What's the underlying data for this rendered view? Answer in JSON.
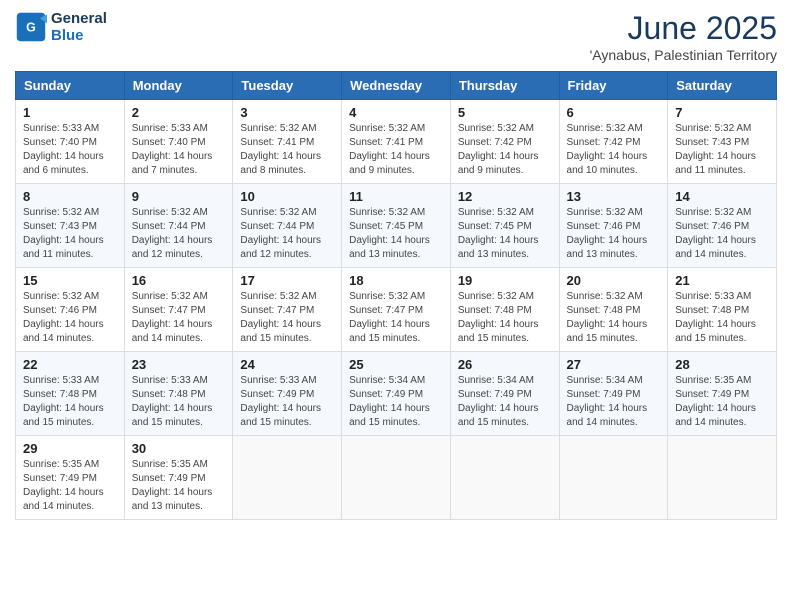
{
  "logo": {
    "line1": "General",
    "line2": "Blue"
  },
  "title": "June 2025",
  "subtitle": "'Aynabus, Palestinian Territory",
  "headers": [
    "Sunday",
    "Monday",
    "Tuesday",
    "Wednesday",
    "Thursday",
    "Friday",
    "Saturday"
  ],
  "weeks": [
    [
      {
        "day": "1",
        "sunrise": "Sunrise: 5:33 AM",
        "sunset": "Sunset: 7:40 PM",
        "daylight": "Daylight: 14 hours and 6 minutes."
      },
      {
        "day": "2",
        "sunrise": "Sunrise: 5:33 AM",
        "sunset": "Sunset: 7:40 PM",
        "daylight": "Daylight: 14 hours and 7 minutes."
      },
      {
        "day": "3",
        "sunrise": "Sunrise: 5:32 AM",
        "sunset": "Sunset: 7:41 PM",
        "daylight": "Daylight: 14 hours and 8 minutes."
      },
      {
        "day": "4",
        "sunrise": "Sunrise: 5:32 AM",
        "sunset": "Sunset: 7:41 PM",
        "daylight": "Daylight: 14 hours and 9 minutes."
      },
      {
        "day": "5",
        "sunrise": "Sunrise: 5:32 AM",
        "sunset": "Sunset: 7:42 PM",
        "daylight": "Daylight: 14 hours and 9 minutes."
      },
      {
        "day": "6",
        "sunrise": "Sunrise: 5:32 AM",
        "sunset": "Sunset: 7:42 PM",
        "daylight": "Daylight: 14 hours and 10 minutes."
      },
      {
        "day": "7",
        "sunrise": "Sunrise: 5:32 AM",
        "sunset": "Sunset: 7:43 PM",
        "daylight": "Daylight: 14 hours and 11 minutes."
      }
    ],
    [
      {
        "day": "8",
        "sunrise": "Sunrise: 5:32 AM",
        "sunset": "Sunset: 7:43 PM",
        "daylight": "Daylight: 14 hours and 11 minutes."
      },
      {
        "day": "9",
        "sunrise": "Sunrise: 5:32 AM",
        "sunset": "Sunset: 7:44 PM",
        "daylight": "Daylight: 14 hours and 12 minutes."
      },
      {
        "day": "10",
        "sunrise": "Sunrise: 5:32 AM",
        "sunset": "Sunset: 7:44 PM",
        "daylight": "Daylight: 14 hours and 12 minutes."
      },
      {
        "day": "11",
        "sunrise": "Sunrise: 5:32 AM",
        "sunset": "Sunset: 7:45 PM",
        "daylight": "Daylight: 14 hours and 13 minutes."
      },
      {
        "day": "12",
        "sunrise": "Sunrise: 5:32 AM",
        "sunset": "Sunset: 7:45 PM",
        "daylight": "Daylight: 14 hours and 13 minutes."
      },
      {
        "day": "13",
        "sunrise": "Sunrise: 5:32 AM",
        "sunset": "Sunset: 7:46 PM",
        "daylight": "Daylight: 14 hours and 13 minutes."
      },
      {
        "day": "14",
        "sunrise": "Sunrise: 5:32 AM",
        "sunset": "Sunset: 7:46 PM",
        "daylight": "Daylight: 14 hours and 14 minutes."
      }
    ],
    [
      {
        "day": "15",
        "sunrise": "Sunrise: 5:32 AM",
        "sunset": "Sunset: 7:46 PM",
        "daylight": "Daylight: 14 hours and 14 minutes."
      },
      {
        "day": "16",
        "sunrise": "Sunrise: 5:32 AM",
        "sunset": "Sunset: 7:47 PM",
        "daylight": "Daylight: 14 hours and 14 minutes."
      },
      {
        "day": "17",
        "sunrise": "Sunrise: 5:32 AM",
        "sunset": "Sunset: 7:47 PM",
        "daylight": "Daylight: 14 hours and 15 minutes."
      },
      {
        "day": "18",
        "sunrise": "Sunrise: 5:32 AM",
        "sunset": "Sunset: 7:47 PM",
        "daylight": "Daylight: 14 hours and 15 minutes."
      },
      {
        "day": "19",
        "sunrise": "Sunrise: 5:32 AM",
        "sunset": "Sunset: 7:48 PM",
        "daylight": "Daylight: 14 hours and 15 minutes."
      },
      {
        "day": "20",
        "sunrise": "Sunrise: 5:32 AM",
        "sunset": "Sunset: 7:48 PM",
        "daylight": "Daylight: 14 hours and 15 minutes."
      },
      {
        "day": "21",
        "sunrise": "Sunrise: 5:33 AM",
        "sunset": "Sunset: 7:48 PM",
        "daylight": "Daylight: 14 hours and 15 minutes."
      }
    ],
    [
      {
        "day": "22",
        "sunrise": "Sunrise: 5:33 AM",
        "sunset": "Sunset: 7:48 PM",
        "daylight": "Daylight: 14 hours and 15 minutes."
      },
      {
        "day": "23",
        "sunrise": "Sunrise: 5:33 AM",
        "sunset": "Sunset: 7:48 PM",
        "daylight": "Daylight: 14 hours and 15 minutes."
      },
      {
        "day": "24",
        "sunrise": "Sunrise: 5:33 AM",
        "sunset": "Sunset: 7:49 PM",
        "daylight": "Daylight: 14 hours and 15 minutes."
      },
      {
        "day": "25",
        "sunrise": "Sunrise: 5:34 AM",
        "sunset": "Sunset: 7:49 PM",
        "daylight": "Daylight: 14 hours and 15 minutes."
      },
      {
        "day": "26",
        "sunrise": "Sunrise: 5:34 AM",
        "sunset": "Sunset: 7:49 PM",
        "daylight": "Daylight: 14 hours and 15 minutes."
      },
      {
        "day": "27",
        "sunrise": "Sunrise: 5:34 AM",
        "sunset": "Sunset: 7:49 PM",
        "daylight": "Daylight: 14 hours and 14 minutes."
      },
      {
        "day": "28",
        "sunrise": "Sunrise: 5:35 AM",
        "sunset": "Sunset: 7:49 PM",
        "daylight": "Daylight: 14 hours and 14 minutes."
      }
    ],
    [
      {
        "day": "29",
        "sunrise": "Sunrise: 5:35 AM",
        "sunset": "Sunset: 7:49 PM",
        "daylight": "Daylight: 14 hours and 14 minutes."
      },
      {
        "day": "30",
        "sunrise": "Sunrise: 5:35 AM",
        "sunset": "Sunset: 7:49 PM",
        "daylight": "Daylight: 14 hours and 13 minutes."
      },
      null,
      null,
      null,
      null,
      null
    ]
  ]
}
